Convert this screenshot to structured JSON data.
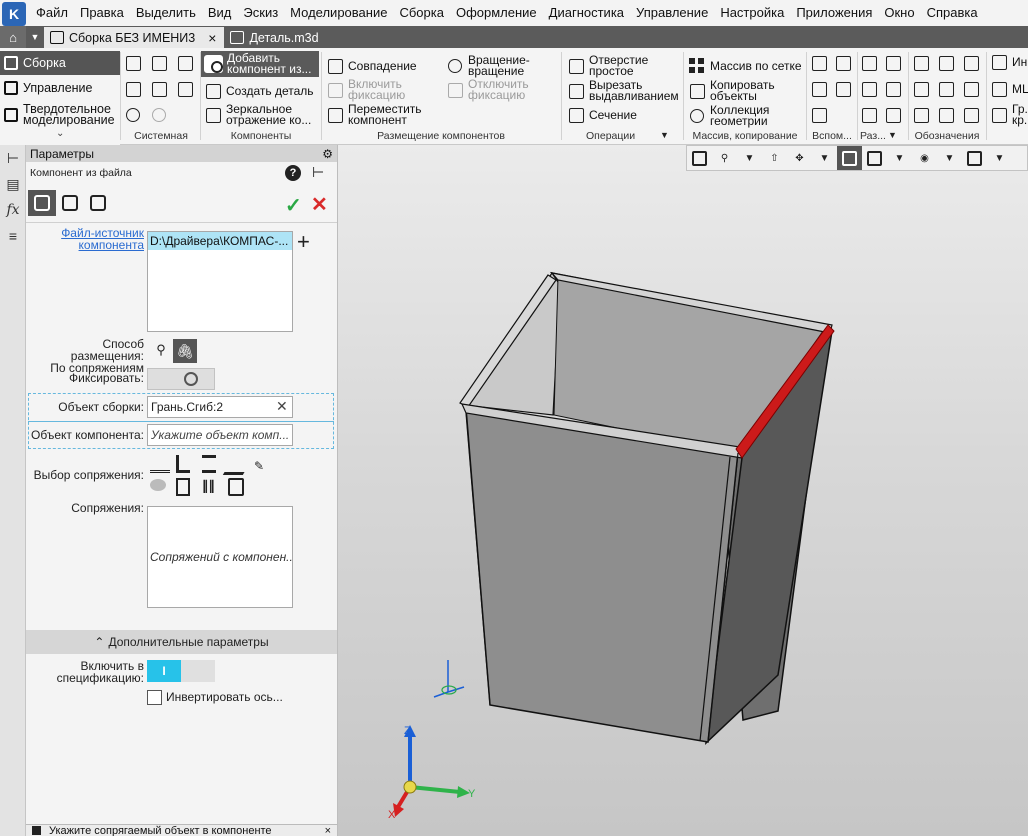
{
  "menubar": {
    "items": [
      "Файл",
      "Правка",
      "Выделить",
      "Вид",
      "Эскиз",
      "Моделирование",
      "Сборка",
      "Оформление",
      "Диагностика",
      "Управление",
      "Настройка",
      "Приложения",
      "Окно",
      "Справка"
    ]
  },
  "tabs": [
    {
      "label": "Сборка БЕЗ ИМЕНИ3",
      "active": true
    },
    {
      "label": "Деталь.m3d",
      "active": false
    }
  ],
  "ribbon": {
    "left_items": [
      "Сборка",
      "Управление",
      "Твердотельное\nмоделирование"
    ],
    "groups": [
      "Системная",
      "Компоненты",
      "Размещение компонентов",
      "Операции",
      "Массив, копирование",
      "Вспом...",
      "Раз...",
      "Обозначения"
    ],
    "buttons": {
      "add_component": "Добавить\nкомпонент из...",
      "create_part": "Создать деталь",
      "mirror": "Зеркальное\nотражение ко...",
      "coincidence": "Совпадение",
      "enable_fix": "Включить\nфиксацию",
      "move_component": "Переместить\nкомпонент",
      "rotation": "Вращение-\nвращение",
      "disable_fix": "Отключить\nфиксацию",
      "hole": "Отверстие\nпростое",
      "cut_extrude": "Вырезать\nвыдавливанием",
      "section": "Сечение",
      "grid_array": "Массив по сетке",
      "copy_objects": "Копировать\nобъекты",
      "geometry_collection": "Коллекция\nгеометрии",
      "right_partial_1": "Ин...",
      "right_partial_2": "МЦ...",
      "right_partial_3": "Гр...\nкр..."
    }
  },
  "panel": {
    "title": "Параметры",
    "subtitle": "Компонент из файла",
    "source_file_label": "Файл-источник\nкомпонента",
    "source_file_value": "D:\\Драйвера\\КОМПАС-...",
    "placement_label": "Способ размещения:\nПо сопряжениям",
    "fix_label": "Фиксировать:",
    "assembly_object_label": "Объект сборки:",
    "assembly_object_value": "Грань.Сгиб:2",
    "component_object_label": "Объект компонента:",
    "component_object_placeholder": "Укажите объект комп...",
    "mate_choice_label": "Выбор сопряжения:",
    "mates_label": "Сопряжения:",
    "mates_placeholder": "Сопряжений с компонен...",
    "advanced_label": "Дополнительные параметры",
    "include_spec_label": "Включить в\nспецификацию:",
    "include_spec_state": "I",
    "invert_axis_label": "Инвертировать ось...",
    "status_text": "Укажите сопрягаемый объект в компоненте"
  },
  "viewport": {
    "triad": {
      "x": "X",
      "y": "Y",
      "z": "Z"
    },
    "highlight_color": "#cc1a1a"
  }
}
